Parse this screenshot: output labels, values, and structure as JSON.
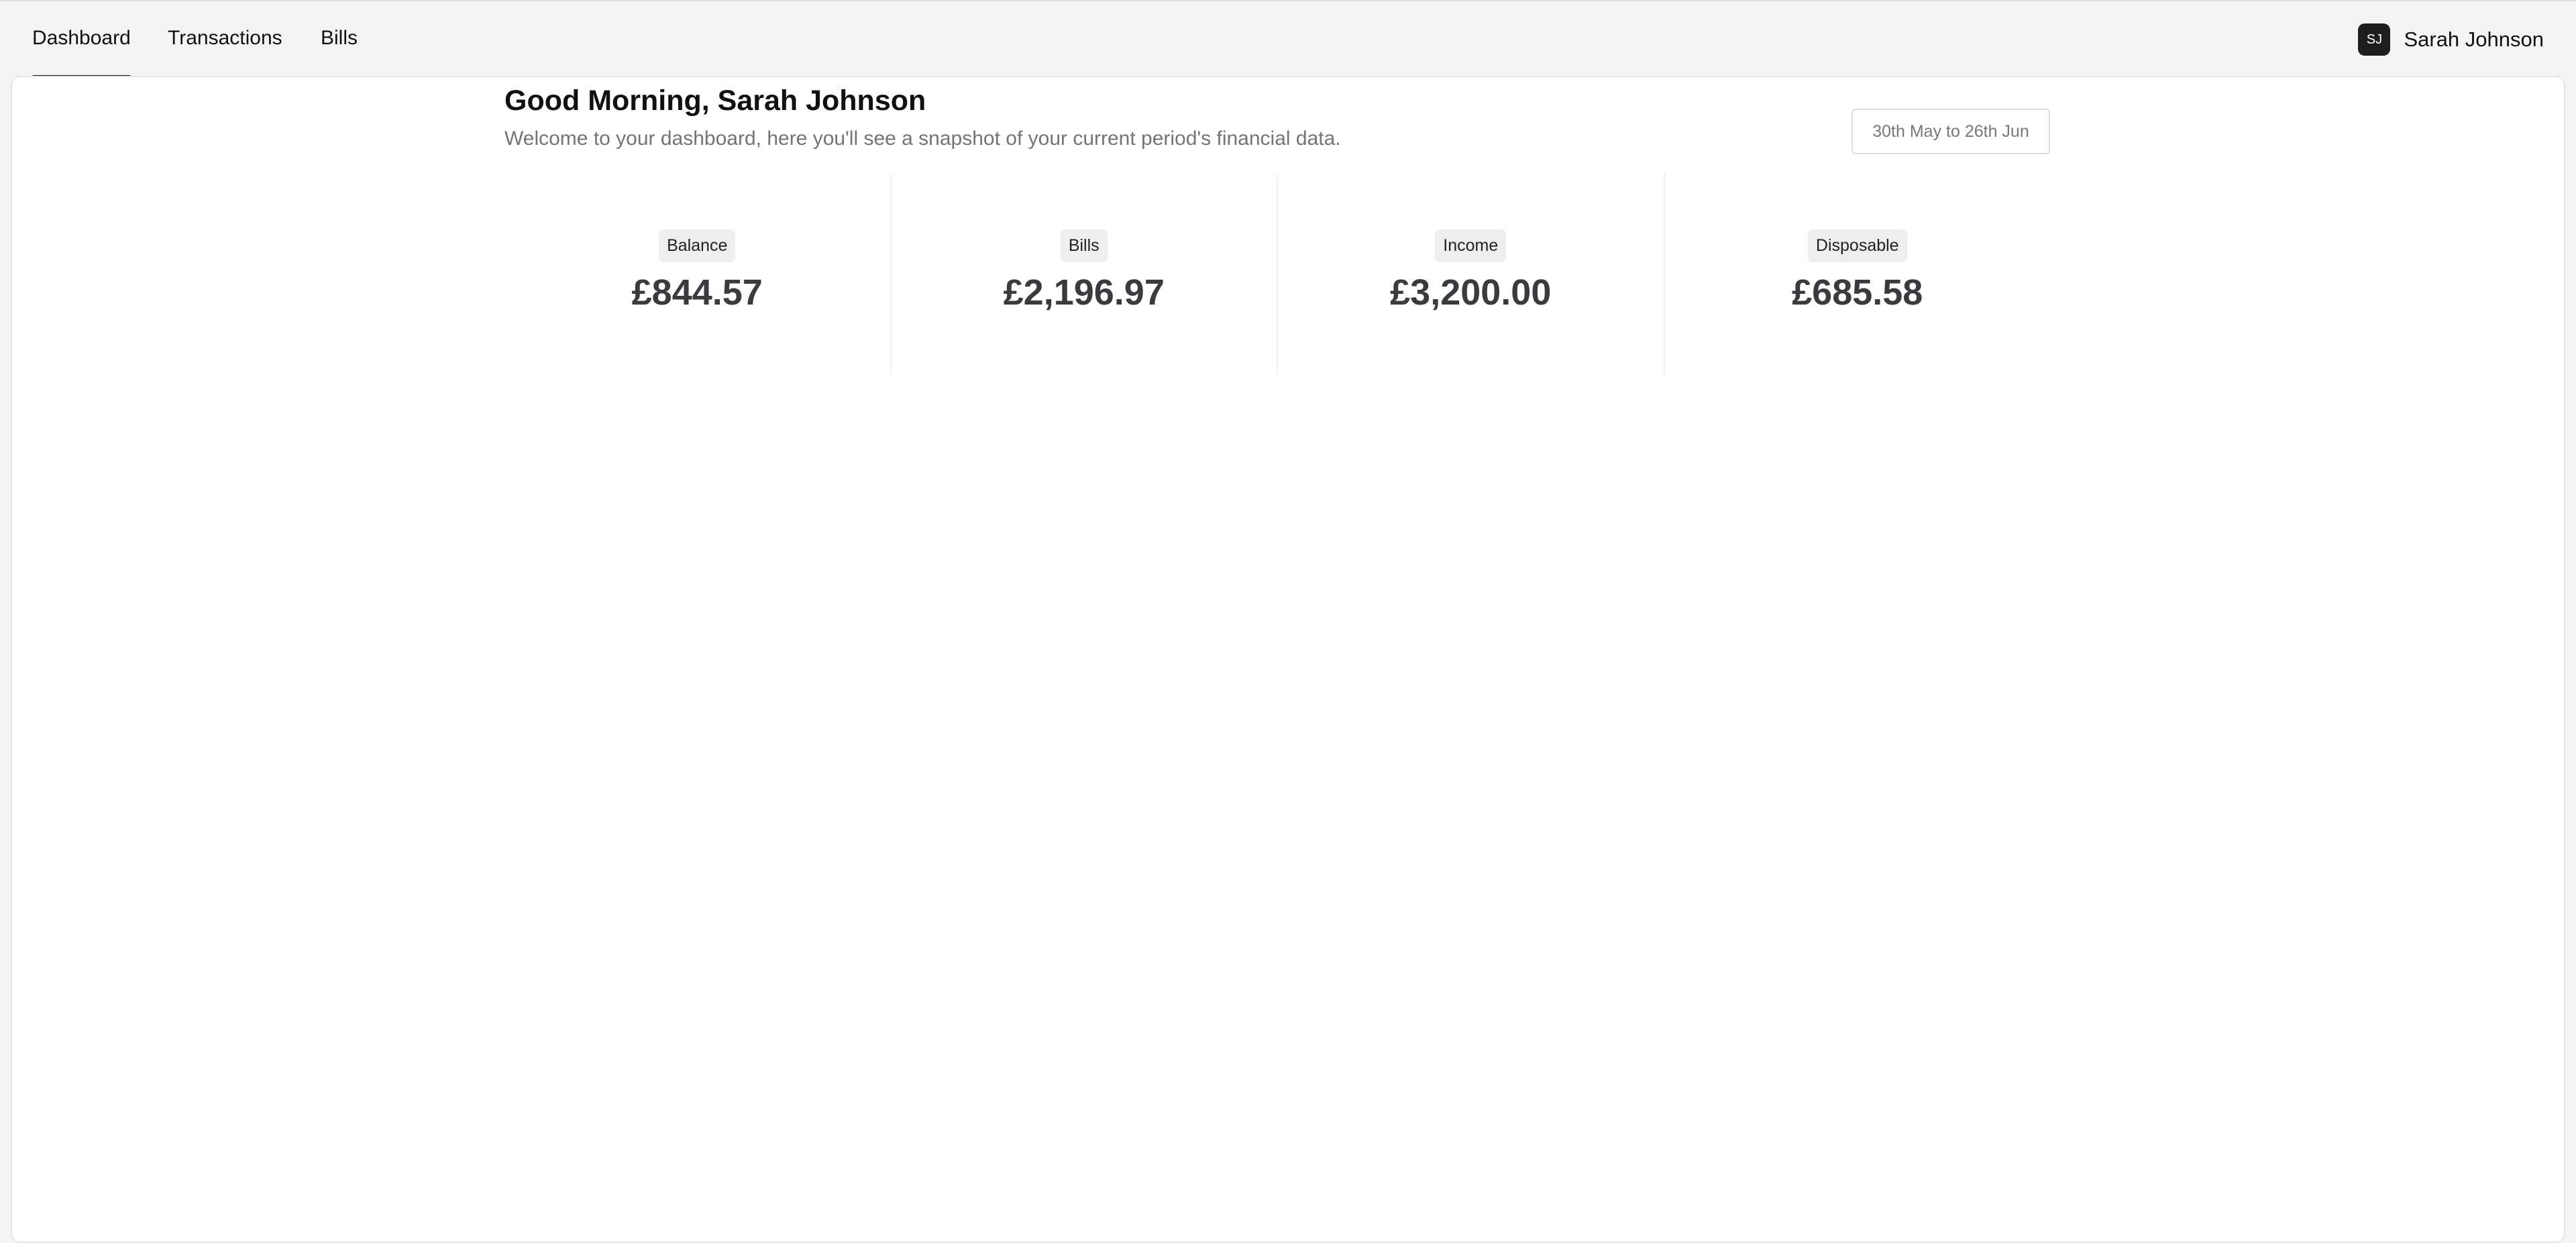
{
  "nav": {
    "tabs": [
      {
        "label": "Dashboard",
        "active": true
      },
      {
        "label": "Transactions",
        "active": false
      },
      {
        "label": "Bills",
        "active": false
      }
    ]
  },
  "user": {
    "initials": "SJ",
    "name": "Sarah Johnson"
  },
  "header": {
    "greeting": "Good Morning, Sarah Johnson",
    "subtitle": "Welcome to your dashboard, here you'll see a snapshot of your current period's financial data.",
    "date_range": "30th May to 26th Jun"
  },
  "stats": [
    {
      "label": "Balance",
      "value": "£844.57"
    },
    {
      "label": "Bills",
      "value": "£2,196.97"
    },
    {
      "label": "Income",
      "value": "£3,200.00"
    },
    {
      "label": "Disposable",
      "value": "£685.58"
    }
  ],
  "colors": {
    "background": "#f4f4f4",
    "card": "#ffffff",
    "accent": "#111111",
    "muted_text": "#747474"
  }
}
